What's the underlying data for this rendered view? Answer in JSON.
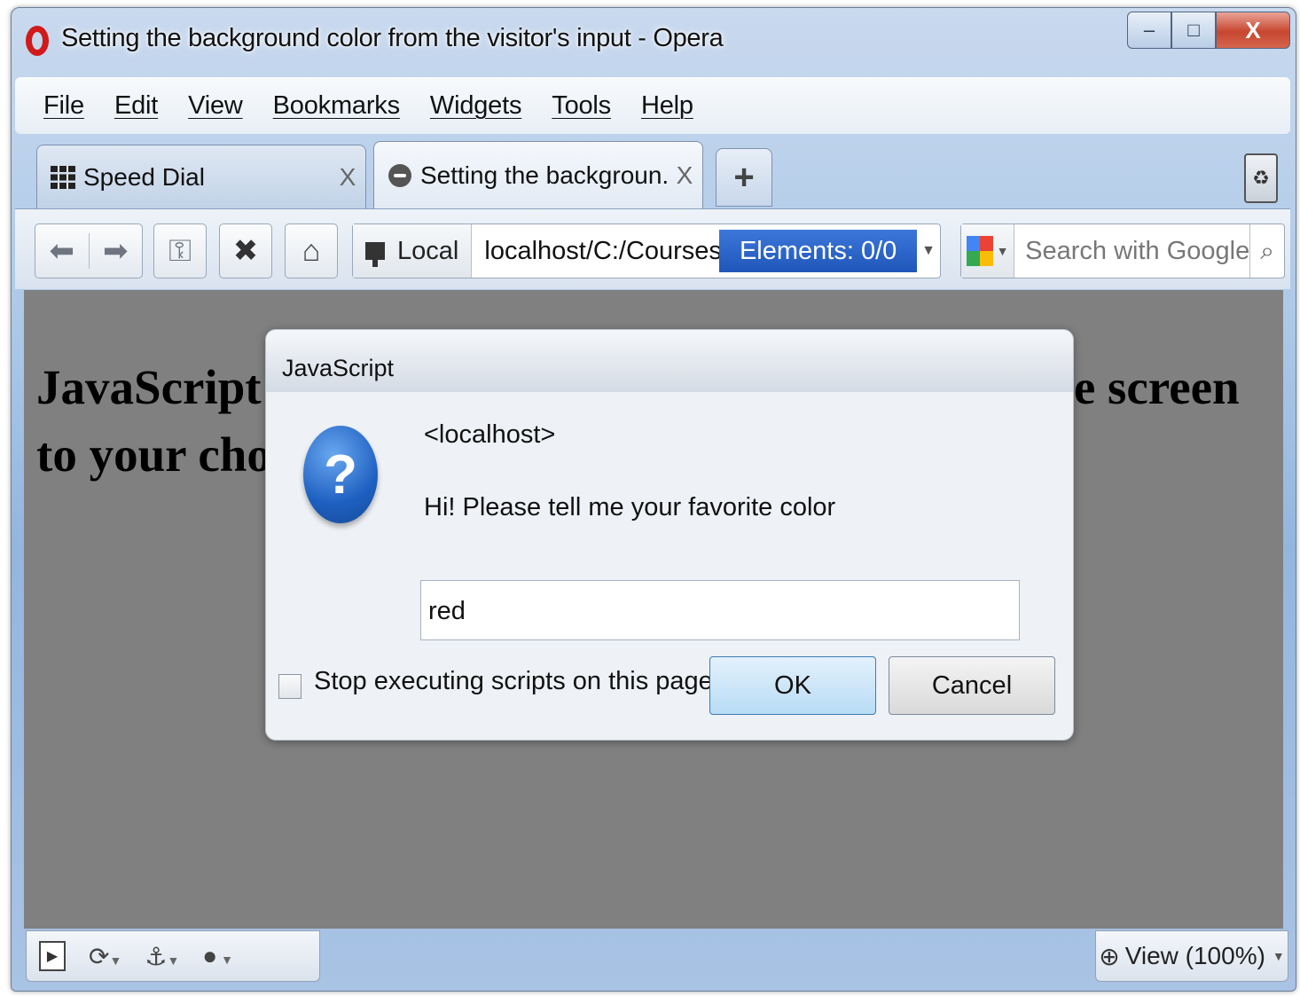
{
  "window": {
    "title": "Setting the background color from the visitor's input - Opera"
  },
  "menu": [
    "File",
    "Edit",
    "View",
    "Bookmarks",
    "Widgets",
    "Tools",
    "Help"
  ],
  "tabs": [
    {
      "label": "Speed Dial",
      "close": "X"
    },
    {
      "label": "Setting the backgroun...",
      "close": "X"
    }
  ],
  "new_tab_label": "+",
  "toolbar": {
    "address_zone": "Local",
    "address_url": "localhost/C:/Courses/C",
    "elements_badge": "Elements:  0/0",
    "search_placeholder": "Search with Google"
  },
  "page": {
    "heading_line1": "JavaScript will change the background color of the screen",
    "heading_line2": "to your choice"
  },
  "dialog": {
    "title": "JavaScript",
    "origin": "<localhost>",
    "message": "Hi!  Please tell me your favorite color",
    "input_value": "red",
    "checkbox_label": "Stop executing scripts on this page",
    "ok_label": "OK",
    "cancel_label": "Cancel"
  },
  "statusbar": {
    "view_zoom": "View (100%)"
  },
  "colors": {
    "page_background": "#808080",
    "elements_badge": "#2a63c7",
    "ok_button": "#b8dcf5"
  }
}
